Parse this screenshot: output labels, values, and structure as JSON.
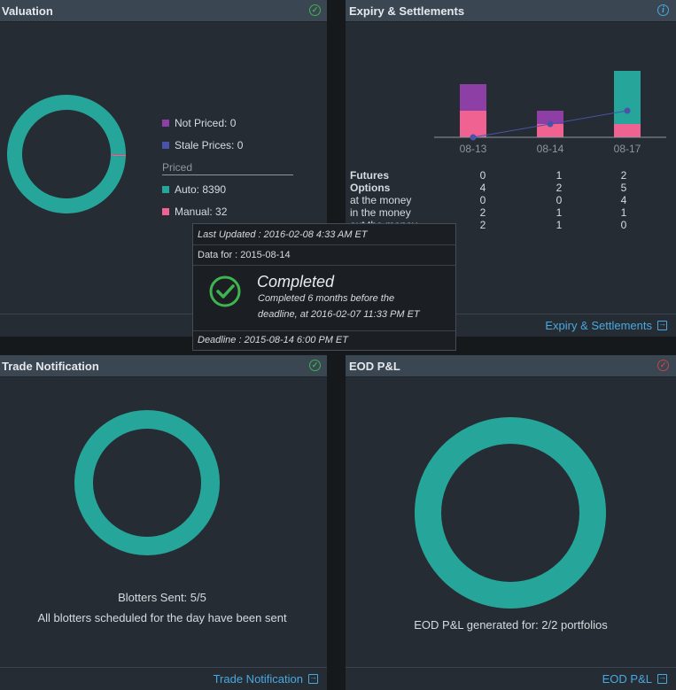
{
  "valuation": {
    "title": "Valuation",
    "legend": {
      "not_priced": "Not Priced: 0",
      "stale_prices": "Stale Prices: 0",
      "priced_heading": "Priced",
      "auto": "Auto: 8390",
      "manual": "Manual: 32"
    },
    "footer_link": ""
  },
  "expiry": {
    "title": "Expiry & Settlements",
    "footer_link": "Expiry & Settlements",
    "table": {
      "rows": [
        {
          "label": "Futures",
          "values": [
            "0",
            "1",
            "2"
          ],
          "bold": true
        },
        {
          "label": "Options",
          "values": [
            "4",
            "2",
            "5"
          ],
          "bold": true
        },
        {
          "label": "at the money",
          "values": [
            "0",
            "0",
            "4"
          ],
          "bold": false
        },
        {
          "label": "in the money",
          "values": [
            "2",
            "1",
            "1"
          ],
          "bold": false
        },
        {
          "label": "out the money",
          "values": [
            "2",
            "1",
            "0"
          ],
          "bold": false
        }
      ]
    }
  },
  "tooltip": {
    "last_updated": "Last Updated : 2016-02-08 4:33 AM ET",
    "data_for": "Data for : 2015-08-14",
    "status": "Completed",
    "detail_line1": "Completed 6 months before the",
    "detail_line2": "deadline, at 2016-02-07 11:33 PM ET",
    "deadline": "Deadline : 2015-08-14 6:00 PM ET"
  },
  "trade": {
    "title": "Trade Notification",
    "sent": "Blotters Sent: 5/5",
    "message": "All blotters scheduled for the day have been sent",
    "footer_link": "Trade Notification"
  },
  "eod": {
    "title": "EOD P&L",
    "message": "EOD P&L generated for: 2/2 portfolios",
    "footer_link": "EOD P&L"
  },
  "colors": {
    "teal": "#26a69a",
    "pink": "#f06292",
    "purple": "#8e3fa5",
    "indigo": "#4954a8",
    "link": "#4aa8e0",
    "ok": "#3fb34f",
    "error": "#c24646"
  },
  "chart_data": [
    {
      "type": "pie",
      "title": "",
      "labels": [
        "Not Priced",
        "Stale Prices",
        "Auto",
        "Manual"
      ],
      "values": [
        0,
        0,
        8390,
        32
      ],
      "colors": [
        "#8e3fa5",
        "#4954a8",
        "#26a69a",
        "#f06292"
      ]
    },
    {
      "type": "bar",
      "title": "",
      "categories": [
        "08-13",
        "08-14",
        "08-17"
      ],
      "series": [
        {
          "values": [
            2,
            1,
            1
          ],
          "color": "#f06292"
        },
        {
          "values": [
            0,
            0,
            4
          ],
          "color": "#26a69a"
        },
        {
          "values": [
            2,
            1,
            0
          ],
          "color": "#8e3fa5"
        }
      ],
      "line": {
        "values": [
          0,
          1,
          2
        ],
        "color": "#4954a8"
      },
      "stacked": true,
      "ylim": [
        0,
        5
      ]
    },
    {
      "type": "pie",
      "title": "",
      "labels": [
        "Sent"
      ],
      "values": [
        5
      ],
      "colors": [
        "#26a69a"
      ]
    },
    {
      "type": "pie",
      "title": "",
      "labels": [
        "Generated"
      ],
      "values": [
        2
      ],
      "colors": [
        "#26a69a"
      ]
    }
  ]
}
